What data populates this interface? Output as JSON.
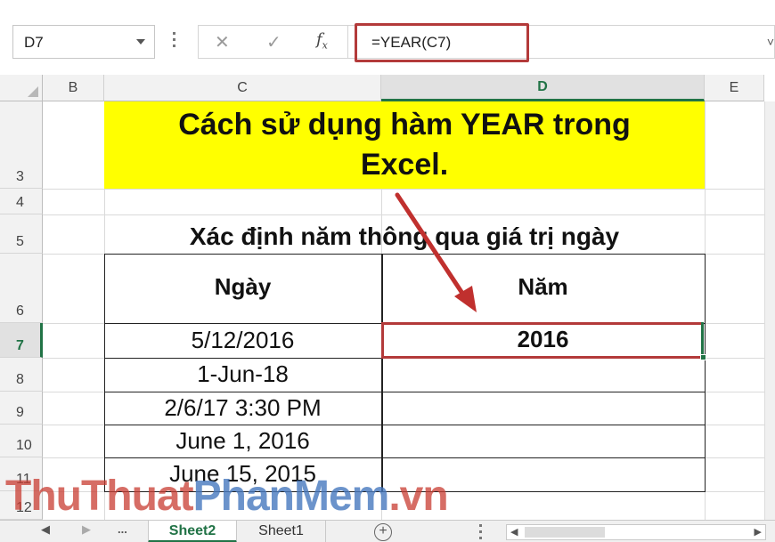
{
  "formula_bar": {
    "name_box": "D7",
    "cancel_icon": "✕",
    "enter_icon": "✓",
    "fx_label": "fx",
    "formula": "=YEAR(C7)",
    "expand_icon": "˅"
  },
  "columns": [
    "B",
    "C",
    "D",
    "E"
  ],
  "rows": [
    "3",
    "4",
    "5",
    "6",
    "7",
    "8",
    "9",
    "10",
    "11",
    "12"
  ],
  "sheet": {
    "title_line1": "Cách sử dụng hàm YEAR trong",
    "title_line2": "Excel.",
    "subtitle": "Xác định năm thông qua giá trị ngày",
    "table": {
      "header_date": "Ngày",
      "header_year": "Năm",
      "dates": [
        "5/12/2016",
        "1-Jun-18",
        "2/6/17 3:30 PM",
        "June 1, 2016",
        "June 15, 2015"
      ],
      "year_result": "2016"
    }
  },
  "watermark": {
    "part1": "ThuThuat",
    "part2": "PhanMem",
    "part3": ".vn"
  },
  "tabs": {
    "nav_prev": "◀",
    "nav_next": "▶",
    "more": "...",
    "sheets": [
      "Sheet2",
      "Sheet1"
    ],
    "add": "+",
    "scroll_left": "◀",
    "scroll_right": "▶"
  },
  "colors": {
    "accent": "#217346",
    "highlight_border": "#b33a3a",
    "title_fill": "#ffff00"
  }
}
